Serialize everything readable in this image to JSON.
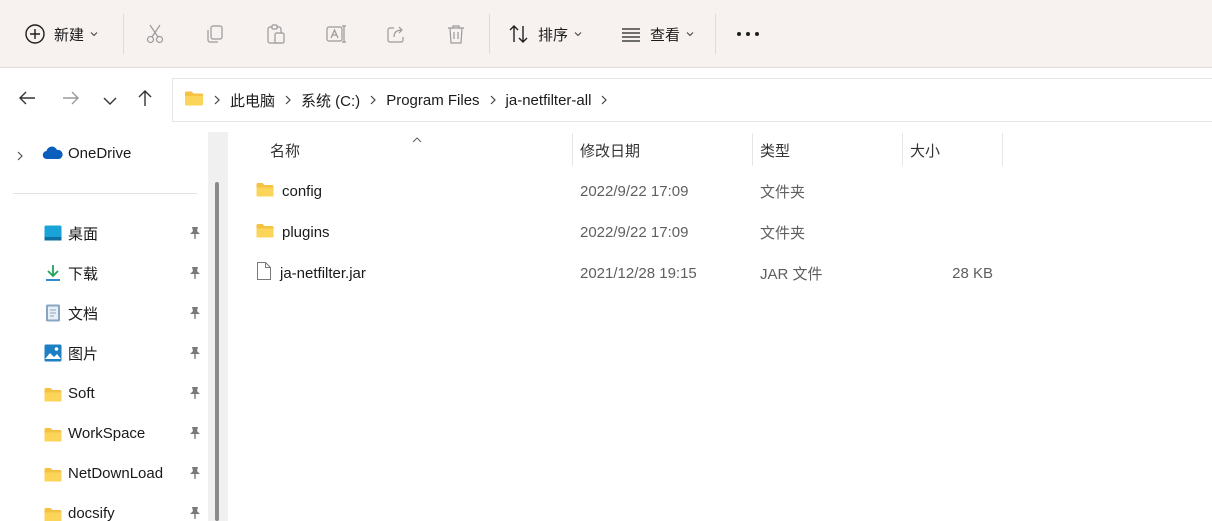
{
  "toolbar": {
    "new_label": "新建",
    "sort_label": "排序",
    "view_label": "查看",
    "icons": [
      "plus-circle-icon",
      "cut-icon",
      "copy-icon",
      "paste-icon",
      "rename-icon",
      "share-icon",
      "delete-icon",
      "sort-icon",
      "view-icon",
      "more-icon"
    ]
  },
  "breadcrumb": {
    "items": [
      "此电脑",
      "系统 (C:)",
      "Program Files",
      "ja-netfilter-all"
    ]
  },
  "sidebar": {
    "onedrive": "OneDrive",
    "quick_access": [
      {
        "label": "桌面",
        "icon": "desktop-icon"
      },
      {
        "label": "下载",
        "icon": "download-icon"
      },
      {
        "label": "文档",
        "icon": "document-icon"
      },
      {
        "label": "图片",
        "icon": "pictures-icon"
      },
      {
        "label": "Soft",
        "icon": "folder-icon"
      },
      {
        "label": "WorkSpace",
        "icon": "folder-icon"
      },
      {
        "label": "NetDownLoad",
        "icon": "folder-icon"
      },
      {
        "label": "docsify",
        "icon": "folder-icon"
      }
    ]
  },
  "columns": {
    "name": "名称",
    "date": "修改日期",
    "type": "类型",
    "size": "大小"
  },
  "files": [
    {
      "name": "config",
      "date": "2022/9/22 17:09",
      "type": "文件夹",
      "size": "",
      "icon": "folder-icon"
    },
    {
      "name": "plugins",
      "date": "2022/9/22 17:09",
      "type": "文件夹",
      "size": "",
      "icon": "folder-icon"
    },
    {
      "name": "ja-netfilter.jar",
      "date": "2021/12/28 19:15",
      "type": "JAR 文件",
      "size": "28 KB",
      "icon": "file-icon"
    }
  ],
  "colors": {
    "toolbar_bg": "#f7f1f0",
    "folder_yellow": "#f5c242",
    "accent_blue": "#0a5fbd"
  }
}
